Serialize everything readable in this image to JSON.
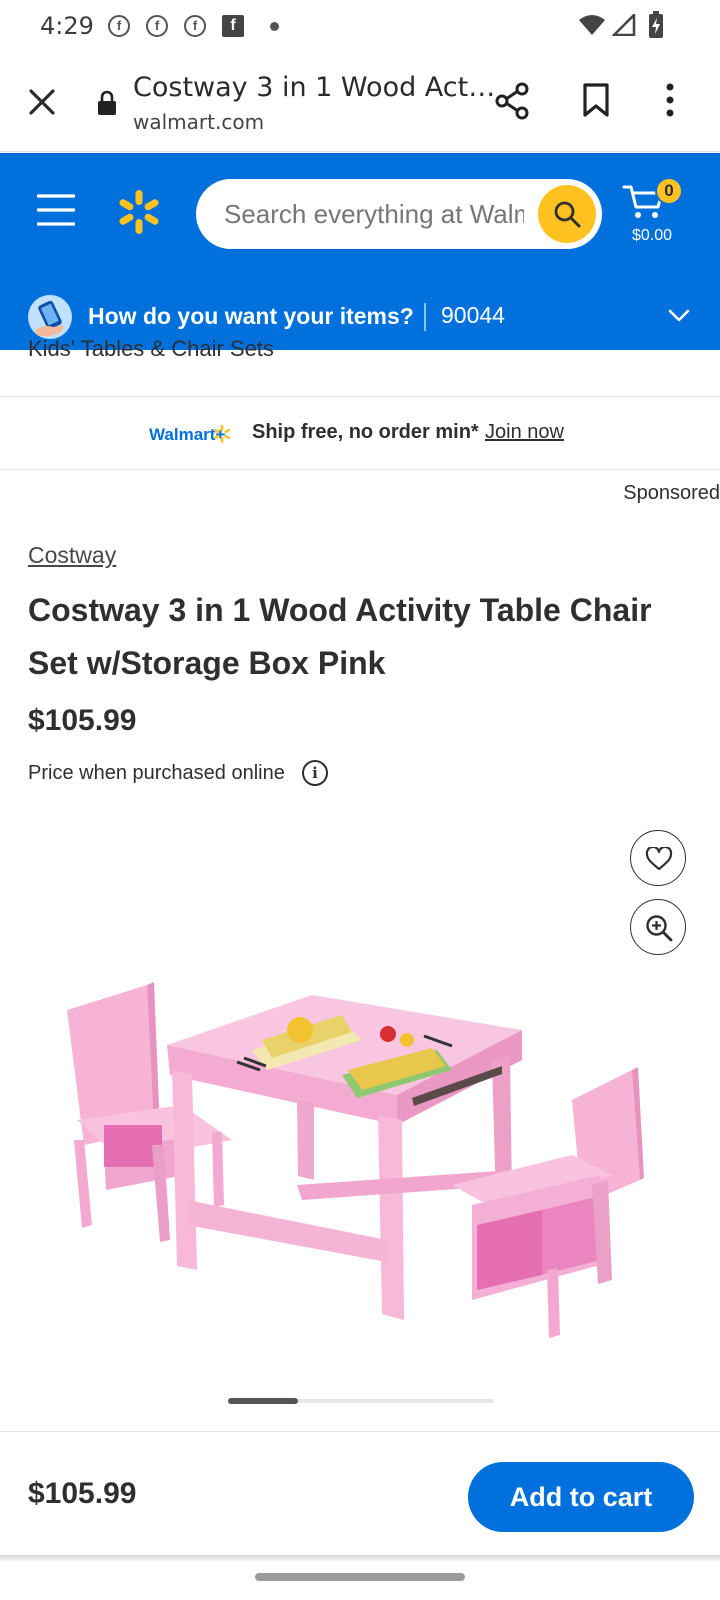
{
  "status_bar": {
    "time": "4:29"
  },
  "browser": {
    "page_title": "Costway 3 in 1 Wood Act…",
    "domain": "walmart.com",
    "icons": [
      "close-icon",
      "lock-icon",
      "share-icon",
      "bookmark-icon",
      "more-vert-icon"
    ]
  },
  "header": {
    "search_placeholder": "Search everything at Walmart online and in store",
    "cart_count": "0",
    "cart_total": "$0.00",
    "delivery_prompt": "How do you want your items?",
    "zip": "90044",
    "brand_color": "#0071dc",
    "accent_color": "#ffc220"
  },
  "breadcrumb": "Kids' Tables & Chair Sets",
  "promo": {
    "logo": "Walmart+",
    "text": "Ship free, no order min*",
    "link": "Join now"
  },
  "sponsored": "Sponsored",
  "product": {
    "brand": "Costway",
    "title": "Costway 3 in 1 Wood Activity Table Chair Set w/Storage Box Pink",
    "price": "$105.99",
    "price_note": "Price when purchased online"
  },
  "bottom_bar": {
    "price": "$105.99",
    "add_to_cart": "Add to cart"
  }
}
